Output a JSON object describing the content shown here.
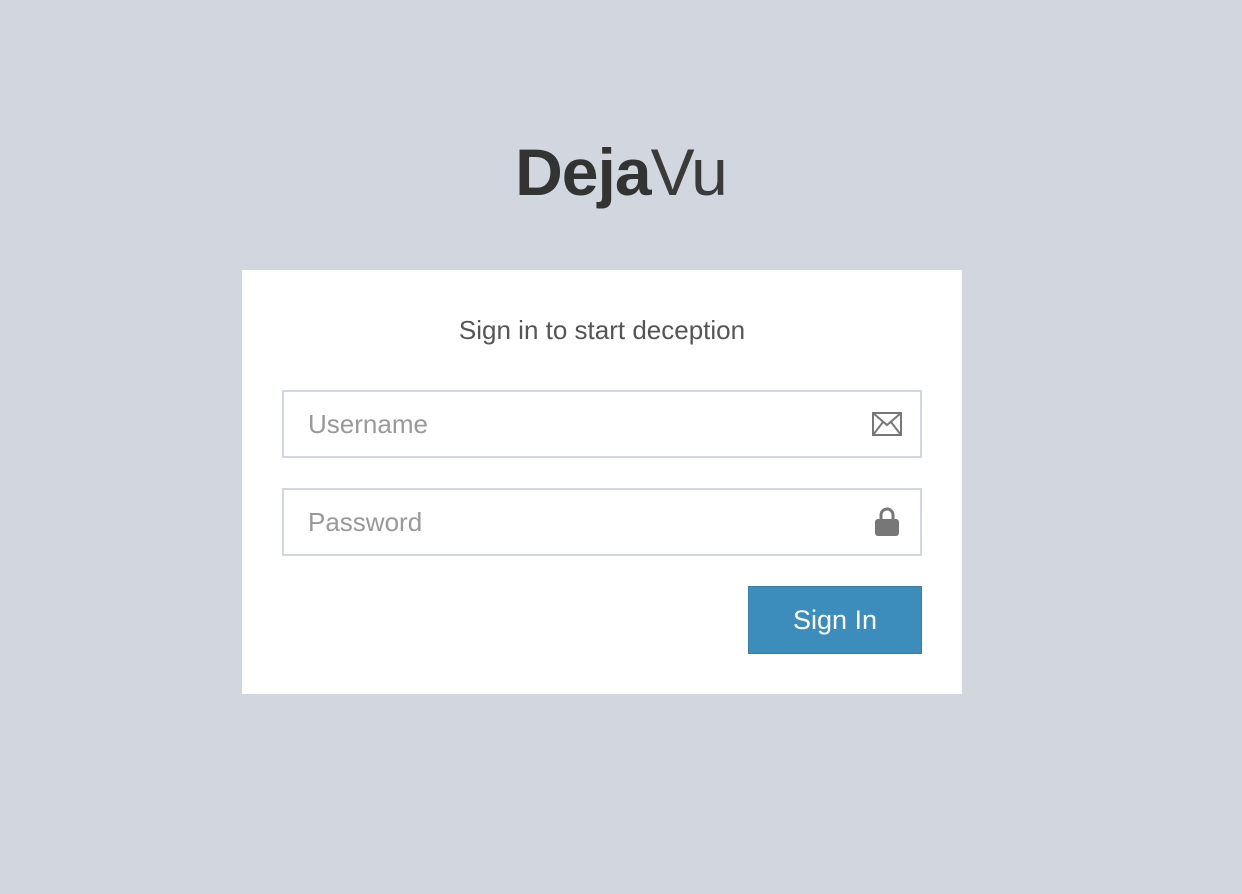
{
  "logo": {
    "bold": "Deja",
    "light": "Vu"
  },
  "login": {
    "message": "Sign in to start deception",
    "username": {
      "value": "",
      "placeholder": "Username",
      "icon": "envelope-icon"
    },
    "password": {
      "value": "",
      "placeholder": "Password",
      "icon": "lock-icon"
    },
    "submit_label": "Sign In"
  },
  "colors": {
    "background": "#d2d6de",
    "panel": "#ffffff",
    "primary_button": "#3c8dbc",
    "icon": "#777777"
  }
}
